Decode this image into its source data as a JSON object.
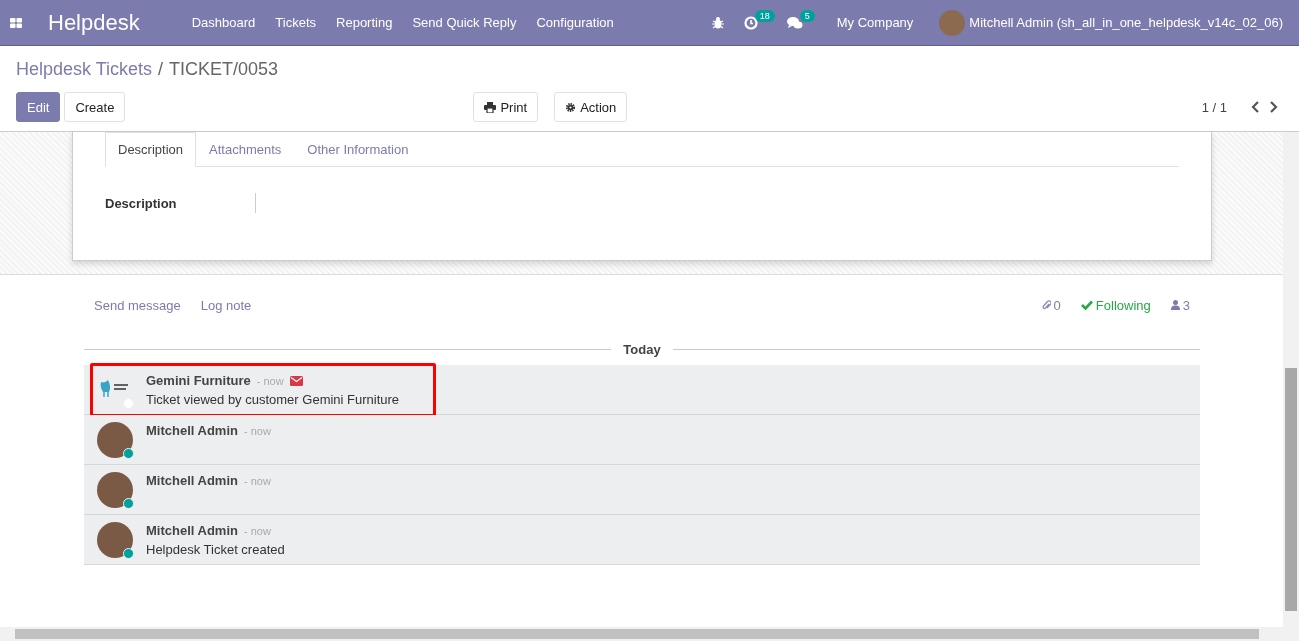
{
  "navbar": {
    "app_name": "Helpdesk",
    "menu": [
      "Dashboard",
      "Tickets",
      "Reporting",
      "Send Quick Reply",
      "Configuration"
    ],
    "activity_count": "18",
    "message_count": "5",
    "company": "My Company",
    "user": "Mitchell Admin (sh_all_in_one_helpdesk_v14c_02_06)"
  },
  "breadcrumb": {
    "parent": "Helpdesk Tickets",
    "separator": "/",
    "current": "TICKET/0053"
  },
  "buttons": {
    "edit": "Edit",
    "create": "Create",
    "print": "Print",
    "action": "Action"
  },
  "pager": "1 / 1",
  "tabs": [
    {
      "label": "Description",
      "selected": true
    },
    {
      "label": "Attachments",
      "selected": false
    },
    {
      "label": "Other Information",
      "selected": false
    }
  ],
  "description_label": "Description",
  "chatter": {
    "send_message": "Send message",
    "log_note": "Log note",
    "attachments": "0",
    "following": "Following",
    "followers": "3",
    "date_separator": "Today",
    "messages": [
      {
        "author": "Gemini Furniture",
        "kind": "company",
        "online": false,
        "date": "- now",
        "via_email": true,
        "highlighted": true,
        "body": "Ticket viewed by customer Gemini Furniture"
      },
      {
        "author": "Mitchell Admin",
        "kind": "person",
        "online": true,
        "date": "- now",
        "via_email": false,
        "highlighted": false
      },
      {
        "author": "Mitchell Admin",
        "kind": "person",
        "online": true,
        "date": "- now",
        "via_email": false,
        "highlighted": false
      },
      {
        "author": "Mitchell Admin",
        "kind": "person",
        "online": true,
        "date": "- now",
        "via_email": false,
        "highlighted": false,
        "body": "Helpdesk Ticket created"
      }
    ]
  }
}
